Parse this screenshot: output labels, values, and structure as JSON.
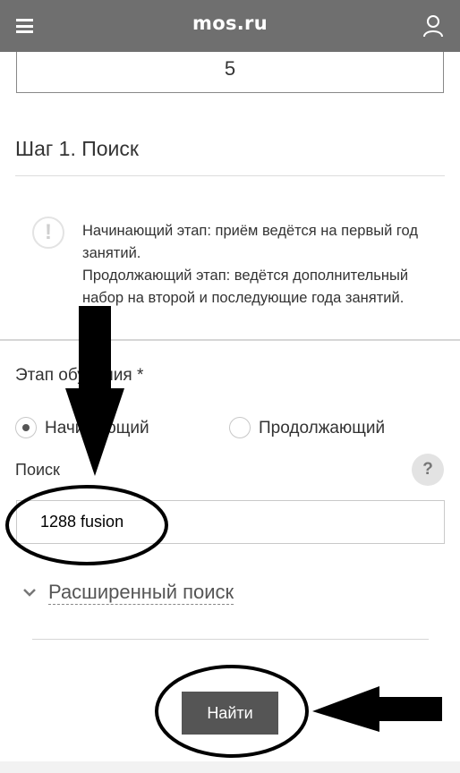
{
  "header": {
    "logo": "mos.ru",
    "menu_icon": "hamburger-menu-icon",
    "user_icon": "user-icon"
  },
  "top_card": {
    "value": "5"
  },
  "step": {
    "title": "Шаг 1. Поиск",
    "info_icon": "exclamation-icon",
    "info_lines": [
      "Начинающий этап: приём ведётся на первый год занятий.",
      "Продолжающий этап: ведётся дополнительный набор на второй и последующие года занятий."
    ]
  },
  "form": {
    "stage_label": "Этап обучения *",
    "stage_options": [
      {
        "label": "Начинающий",
        "selected": true
      },
      {
        "label": "Продолжающий",
        "selected": false
      }
    ],
    "search_label": "Поиск",
    "help_icon_text": "?",
    "search_value": "1288 fusion",
    "advanced_search": "Расширенный поиск",
    "submit_label": "Найти"
  },
  "colors": {
    "header_bg": "#6f6f6f",
    "button_bg": "#555555",
    "page_bg": "#f2f2f2"
  }
}
